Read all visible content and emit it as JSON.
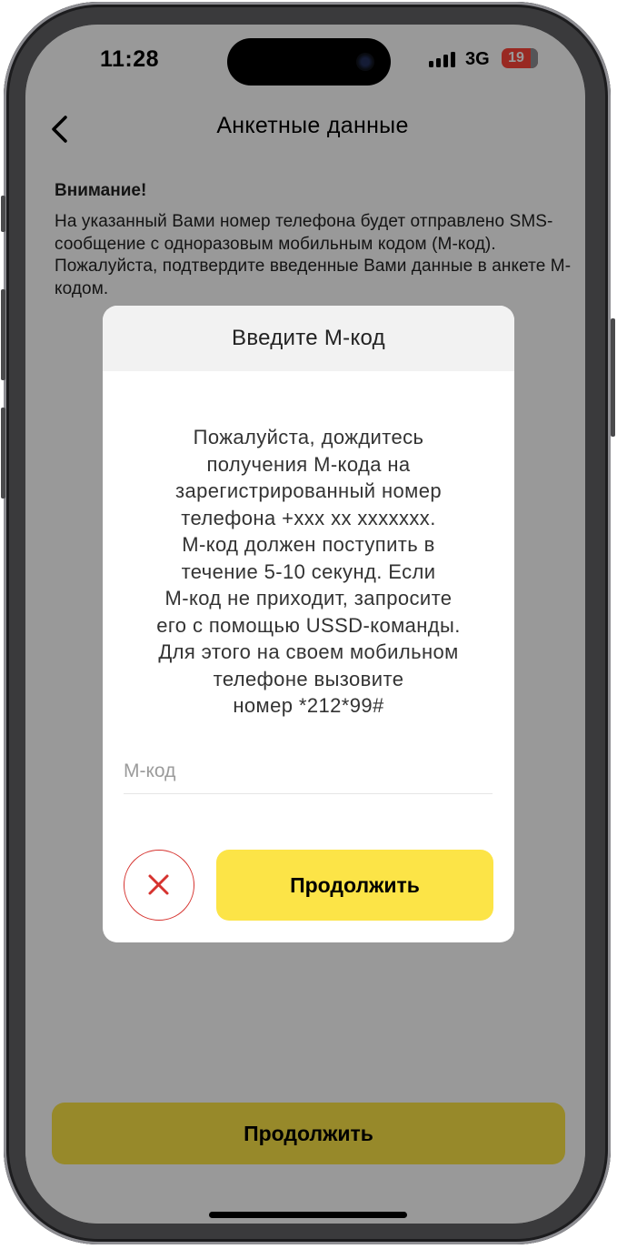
{
  "status_bar": {
    "time": "11:28",
    "network": "3G",
    "battery": "19"
  },
  "header": {
    "title": "Анкетные данные",
    "back_icon": "chevron-left-icon"
  },
  "notice": {
    "title": "Внимание!",
    "text": "На указанный Вами номер телефона будет отправлено SMS-сообщение с одноразовым мобильным кодом (М-код). Пожалуйста, подтвердите введенные Вами данные в анкете М-кодом."
  },
  "footer": {
    "continue_label": "Продолжить"
  },
  "dialog": {
    "title": "Введите М-код",
    "message": "Пожалуйста, дождитесь\nполучения М-кода на\nзарегистрированный номер\nтелефона +xxx xx xxxxxxx.\nМ-код должен поступить в\nтечение 5-10 секунд. Если\nМ-код не приходит, запросите\nего с помощью USSD-команды.\nДля этого на своем мобильном\nтелефоне вызовите\nномер *212*99#",
    "input": {
      "placeholder": "М-код",
      "value": ""
    },
    "cancel_icon": "close-icon",
    "continue_label": "Продолжить"
  },
  "colors": {
    "accent": "#fce447",
    "cancel": "#d6332f",
    "battery_low": "#ff453a"
  }
}
